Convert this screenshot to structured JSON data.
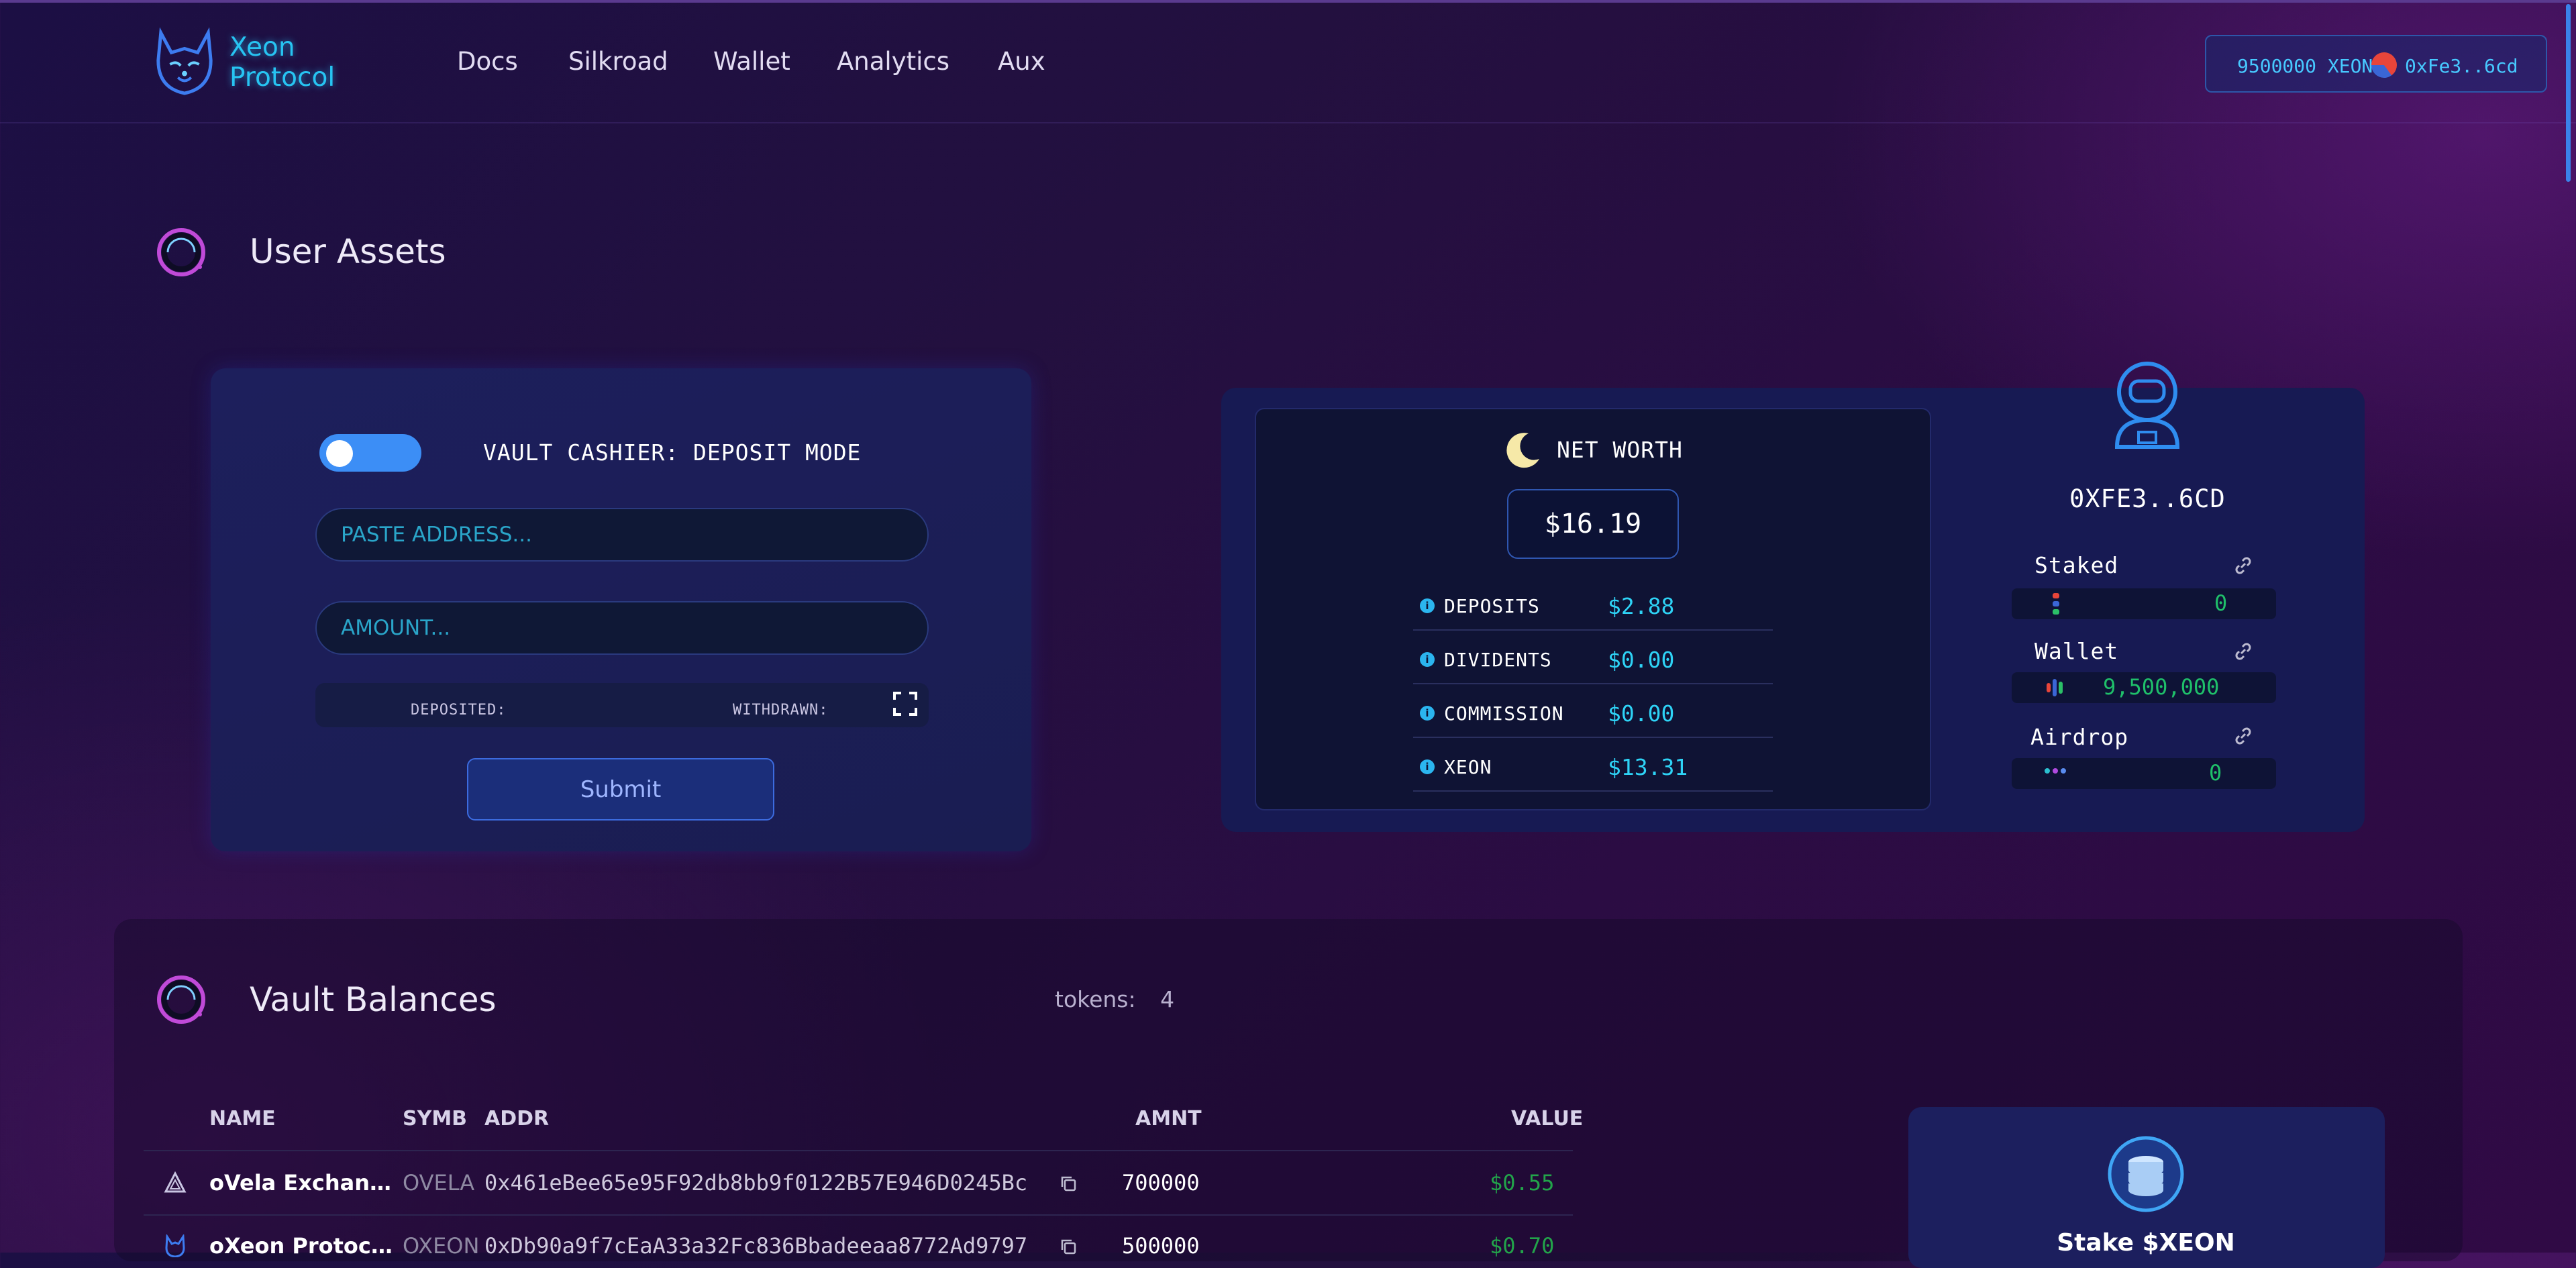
{
  "brand": {
    "line1": "Xeon",
    "line2": "Protocol"
  },
  "nav": [
    "Docs",
    "Silkroad",
    "Wallet",
    "Analytics",
    "Aux"
  ],
  "wallet_pill": {
    "balance": "9500000 XEON",
    "address": "0xFe3..6cd"
  },
  "user_assets": {
    "title": "User Assets",
    "cashier": {
      "mode_label": "VAULT CASHIER: DEPOSIT MODE",
      "toggle_on": true,
      "address_placeholder": "PASTE ADDRESS...",
      "amount_placeholder": "AMOUNT...",
      "deposited_label": "DEPOSITED:",
      "withdrawn_label": "WITHDRAWN:",
      "submit_label": "Submit"
    },
    "net_worth": {
      "title": "NET WORTH",
      "value": "$16.19",
      "rows": [
        {
          "label": "DEPOSITS",
          "value": "$2.88"
        },
        {
          "label": "DIVIDENTS",
          "value": "$0.00"
        },
        {
          "label": "COMMISSION",
          "value": "$0.00"
        },
        {
          "label": "XEON",
          "value": "$13.31"
        }
      ]
    },
    "profile": {
      "address": "0XFE3..6CD",
      "assets": [
        {
          "label": "Staked",
          "value": "0"
        },
        {
          "label": "Wallet",
          "value": "9,500,000"
        },
        {
          "label": "Airdrop",
          "value": "0"
        }
      ]
    }
  },
  "vault_balances": {
    "title": "Vault Balances",
    "tokens_label": "tokens:",
    "tokens_count": "4",
    "columns": [
      "NAME",
      "SYMB",
      "ADDR",
      "AMNT",
      "VALUE"
    ],
    "rows": [
      {
        "name": "oVela Exchan…",
        "symbol": "OVELA",
        "address": "0x461eBee65e95F92db8bb9f0122B57E946D0245Bc",
        "amount": "700000",
        "value": "$0.55"
      },
      {
        "name": "oXeon Protoc…",
        "symbol": "OXEON",
        "address": "0xDb90a9f7cEaA33a32Fc836Bbadeeaa8772Ad9797",
        "amount": "500000",
        "value": "$0.70"
      }
    ],
    "stake_card": {
      "label": "Stake $XEON"
    }
  },
  "colors": {
    "accent": "#27c4f2",
    "positive": "#22a44a",
    "toggle": "#3c8ef6"
  }
}
